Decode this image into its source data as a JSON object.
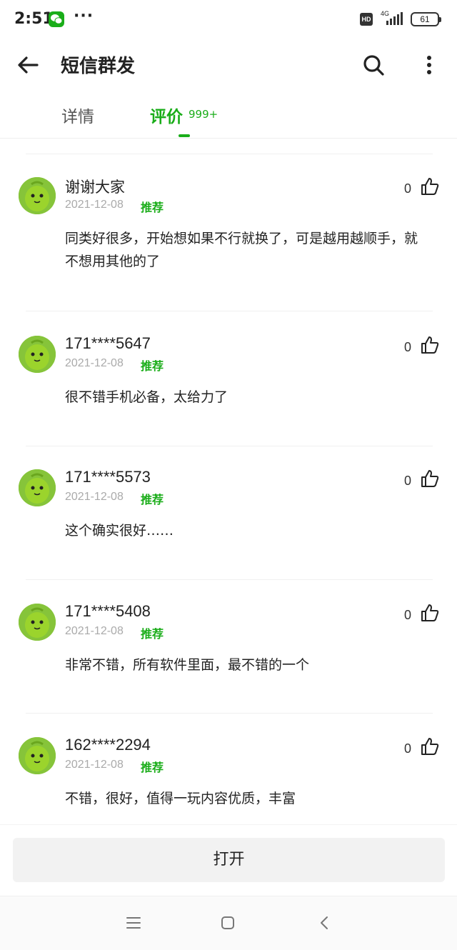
{
  "status_bar": {
    "time": "2:51",
    "app_icon": "wechat-icon",
    "more": "···",
    "hd_badge": "HD",
    "network": "4G",
    "battery": "61"
  },
  "header": {
    "title": "短信群发",
    "back_icon": "back-arrow-icon",
    "search_icon": "search-icon",
    "more_icon": "more-vertical-icon"
  },
  "tabs": [
    {
      "label": "详情",
      "active": false
    },
    {
      "label": "评价",
      "active": true,
      "count": "999+"
    }
  ],
  "accent_color": "#1aad19",
  "reviews": [
    {
      "name": "谢谢大家",
      "date": "2021-12-08",
      "tag": "推荐",
      "likes": "0",
      "text": "同类好很多，开始想如果不行就换了，可是越用越顺手，就不想用其他的了"
    },
    {
      "name": "171****5647",
      "date": "2021-12-08",
      "tag": "推荐",
      "likes": "0",
      "text": "很不错手机必备，太给力了"
    },
    {
      "name": "171****5573",
      "date": "2021-12-08",
      "tag": "推荐",
      "likes": "0",
      "text": "这个确实很好……"
    },
    {
      "name": "171****5408",
      "date": "2021-12-08",
      "tag": "推荐",
      "likes": "0",
      "text": "非常不错，所有软件里面，最不错的一个"
    },
    {
      "name": "162****2294",
      "date": "2021-12-08",
      "tag": "推荐",
      "likes": "0",
      "text": "不错，很好，值得一玩内容优质，丰富"
    }
  ],
  "open_button": {
    "label": "打开"
  },
  "nav_bar": {
    "menu_icon": "menu-icon",
    "home_icon": "home-icon",
    "back_icon": "back-icon"
  }
}
